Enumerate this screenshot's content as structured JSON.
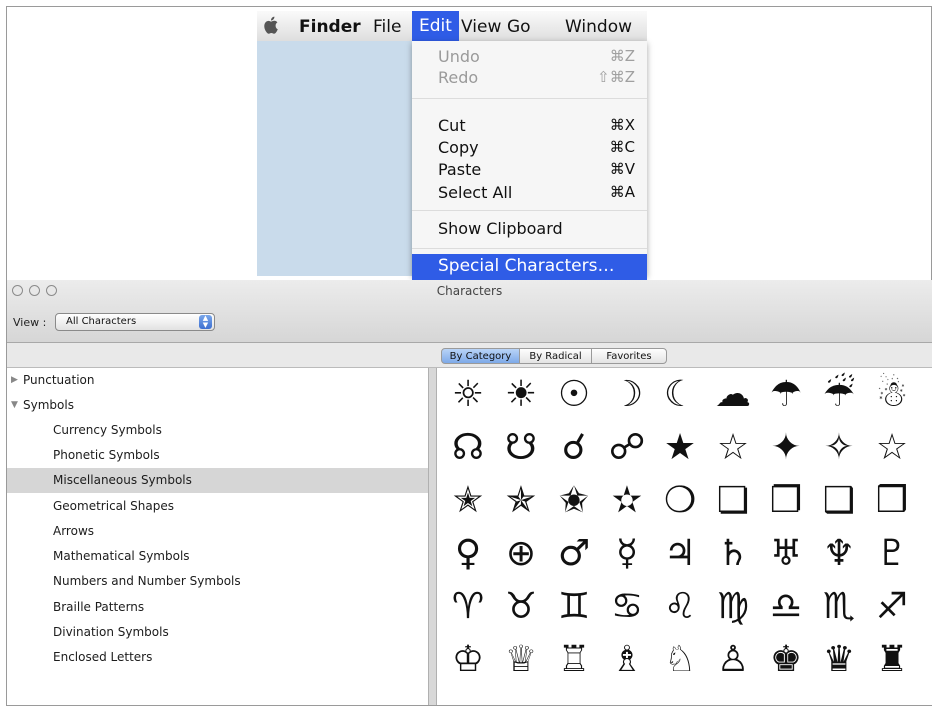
{
  "menubar": {
    "app_name": "Finder",
    "items": [
      "File",
      "Edit",
      "View",
      "Go",
      "Window"
    ]
  },
  "edit_menu": {
    "items": [
      {
        "label": "Undo",
        "shortcut": "⌘Z"
      },
      {
        "label": "Redo",
        "shortcut": "⇧⌘Z"
      },
      {
        "label": "Cut",
        "shortcut": "⌘X"
      },
      {
        "label": "Copy",
        "shortcut": "⌘C"
      },
      {
        "label": "Paste",
        "shortcut": "⌘V"
      },
      {
        "label": "Select All",
        "shortcut": "⌘A"
      },
      {
        "label": "Show Clipboard",
        "shortcut": ""
      },
      {
        "label": "Special Characters…",
        "shortcut": ""
      }
    ]
  },
  "characters_window": {
    "title": "Characters",
    "view_label": "View :",
    "view_value": "All Characters",
    "tabs": [
      "By Category",
      "By Radical",
      "Favorites"
    ],
    "categories": [
      {
        "label": "Punctuation"
      },
      {
        "label": "Symbols"
      },
      {
        "label": "Currency Symbols"
      },
      {
        "label": "Phonetic Symbols"
      },
      {
        "label": "Miscellaneous Symbols"
      },
      {
        "label": "Geometrical Shapes"
      },
      {
        "label": "Arrows"
      },
      {
        "label": "Mathematical Symbols"
      },
      {
        "label": "Numbers and Number Symbols"
      },
      {
        "label": "Braille Patterns"
      },
      {
        "label": "Divination Symbols"
      },
      {
        "label": "Enclosed Letters"
      }
    ],
    "glyph_rows": [
      [
        "☼",
        "☀",
        "☉",
        "☽",
        "☾",
        "☁",
        "☂",
        "☔",
        "☃"
      ],
      [
        "☊",
        "☋",
        "☌",
        "☍",
        "★",
        "☆",
        "✦",
        "✧",
        "☆"
      ],
      [
        "✭",
        "✯",
        "✬",
        "✫",
        "❍",
        "❏",
        "❐",
        "❑",
        "❒"
      ],
      [
        "♀",
        "⊕",
        "♂",
        "☿",
        "♃",
        "♄",
        "♅",
        "♆",
        "♇"
      ],
      [
        "♈",
        "♉",
        "♊",
        "♋",
        "♌",
        "♍",
        "♎",
        "♏",
        "♐"
      ],
      [
        "♔",
        "♕",
        "♖",
        "♗",
        "♘",
        "♙",
        "♚",
        "♛",
        "♜"
      ]
    ]
  }
}
